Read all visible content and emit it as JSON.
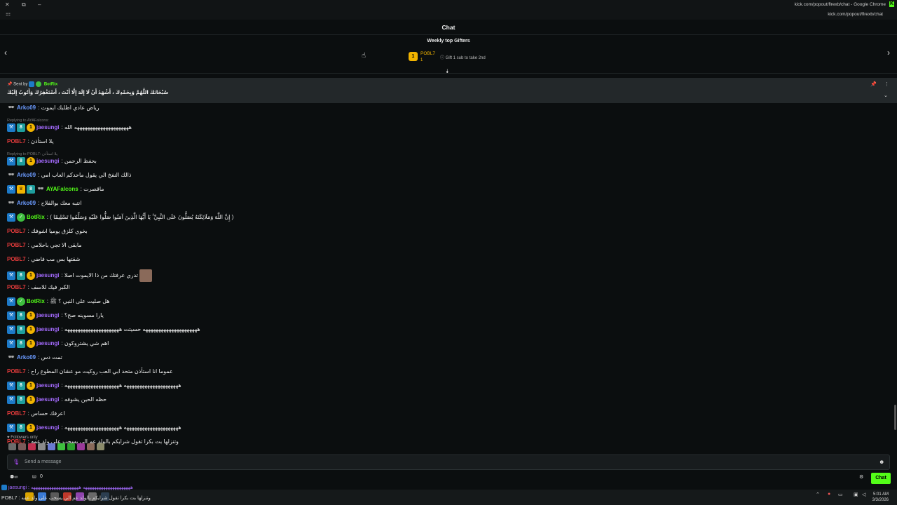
{
  "window": {
    "title": "kick.com/popout/flrexb/chat - Google Chrome",
    "url": "kick.com/popout/flrexb/chat"
  },
  "header": {
    "title": "Chat",
    "gifters_title": "Weekly top Gifters"
  },
  "gifter": {
    "rank": "1",
    "name": "POBL7",
    "count": "1",
    "hint": "Gift 1 sub to take 2nd"
  },
  "pinned": {
    "sent_by": "Sent by",
    "bot_name": "BotRix",
    "message": "سُبْحَانَكَ اللَّهُمَّ وَبِحَمْدِكَ ، أَشْهَدُ أَنْ لَا إِلَهَ إِلَّا أَنْتَ ، أَسْتَغْفِرُكَ وَأَتُوبُ إِلَيْكَ"
  },
  "messages": [
    {
      "user": "Arko09",
      "text": "رياض عادي اطلبك ايموت"
    },
    {
      "reply": "Replying to AYAFalcons:",
      "user": "jaesungi",
      "text": "هههههههههههههههههههههه الله"
    },
    {
      "user": "POBL7",
      "text": "يلا استأذن"
    },
    {
      "reply": "Replying to POBL7: يلا استأذن",
      "user": "jaesungi",
      "text": "بحفظ الرحمن"
    },
    {
      "user": "Arko09",
      "text": "ذالك النفخ الي يقول ماحدكم العاب امي"
    },
    {
      "user": "AYAFalcons",
      "text": "ماقصرت"
    },
    {
      "user": "Arko09",
      "text": "انتبه معك بوالفلاح"
    },
    {
      "user": "BotRix",
      "text": "( إِنَّ اللَّهَ وَمَلَائِكَتَهُ يُصَلُّونَ عَلَى النَّبِيِّ ۚ يَا أَيُّهَا الَّذِينَ آمَنُوا صَلُّوا عَلَيْهِ وَسَلِّمُوا تَسْلِيمًا )"
    },
    {
      "user": "POBL7",
      "text": "بخوي كلزق يوميا اشوفك"
    },
    {
      "user": "POBL7",
      "text": "مابقى الا تجي باحلامي"
    },
    {
      "user": "POBL7",
      "text": "شقتها بس مب فاضي"
    },
    {
      "user": "jaesungi",
      "text": "تدري عرفتك من ذا الايموت اصلا"
    },
    {
      "user": "POBL7",
      "text": "الكبر فيك للاسف"
    },
    {
      "user": "BotRix",
      "text": "هل صليت على النبي ؟ ﷺ"
    },
    {
      "user": "jaesungi",
      "text": "يارا مسوينه صح؟"
    },
    {
      "user": "jaesungi",
      "text": "هههههههههههههههههههههه حسيتت هههههههههههههههههههههه"
    },
    {
      "user": "jaesungi",
      "text": "اهم شي يشتروكون"
    },
    {
      "user": "Arko09",
      "text": "تمت دس"
    },
    {
      "user": "POBL7",
      "text": "عموما انا استأذن متحد ابي العب روكيت مو عشان المطوع راح"
    },
    {
      "user": "jaesungi",
      "text": "هههههههههههههههههههههه هههههههههههههههههههههه"
    },
    {
      "user": "jaesungi",
      "text": "حظه الحين يشوفه"
    },
    {
      "user": "POBL7",
      "text": "اعرفك حساس"
    },
    {
      "user": "jaesungi",
      "text": "هههههههههههههههههههههه هههههههههههههههههههههه"
    },
    {
      "user": "POBL7",
      "text": "وتنزلها بت بكرا تقول شرايكم بالولد عم الي يسحب على ولد عمه"
    }
  ],
  "followers_only": "Followers only",
  "input": {
    "placeholder": "Send a message"
  },
  "bottom": {
    "count": "0",
    "chat_button": "Chat"
  },
  "overlay": {
    "line1": "jaesungi : هههههههههههههههههههههه هههههههههههههههههههههه",
    "line2": "POBL7 : وتنزلها بت بكرا تقول شرايكم بالولد عم الي يسحب على ولد عمه"
  },
  "clock": {
    "time": "5:01 AM",
    "date": "3/3/2026"
  }
}
